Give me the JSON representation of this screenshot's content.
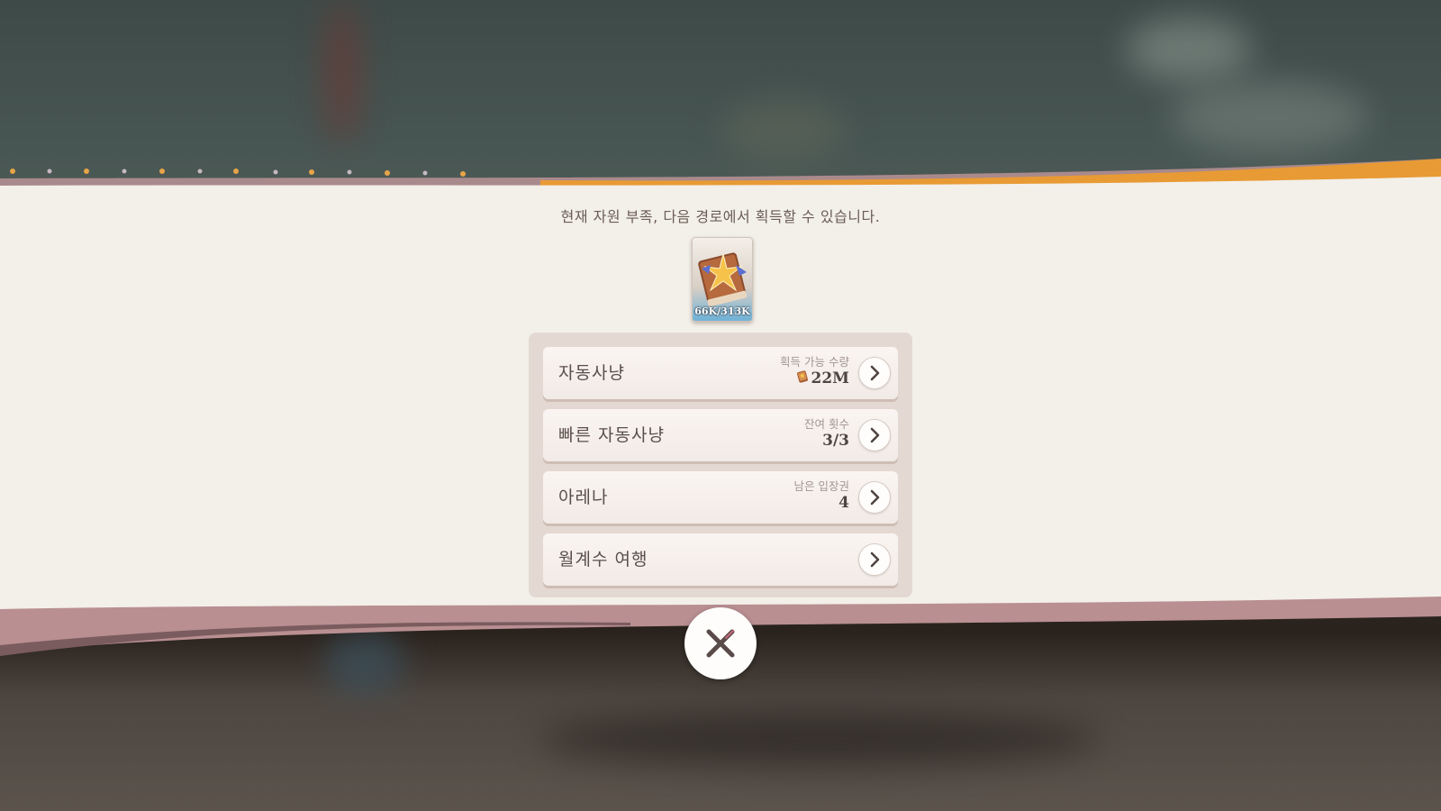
{
  "dialog": {
    "message": "현재 자원 부족, 다음 경로에서 획득할 수 있습니다.",
    "item": {
      "icon": "skill-book-icon",
      "count": "66K/313K"
    },
    "routes": [
      {
        "label": "자동사냥",
        "caption": "획득 가능 수량",
        "value": "22M",
        "value_icon": "coin-icon"
      },
      {
        "label": "빠른 자동사냥",
        "caption": "잔여 횟수",
        "value": "3/3"
      },
      {
        "label": "아레나",
        "caption": "남은 입장권",
        "value": "4"
      },
      {
        "label": "월계수 여행",
        "caption": "",
        "value": ""
      }
    ],
    "close_icon": "close-icon"
  },
  "colors": {
    "banner_paper": "#f3efe9",
    "accent_orange": "#e89a34",
    "panel": "#e4d9d2",
    "row": "#f5eeea"
  }
}
